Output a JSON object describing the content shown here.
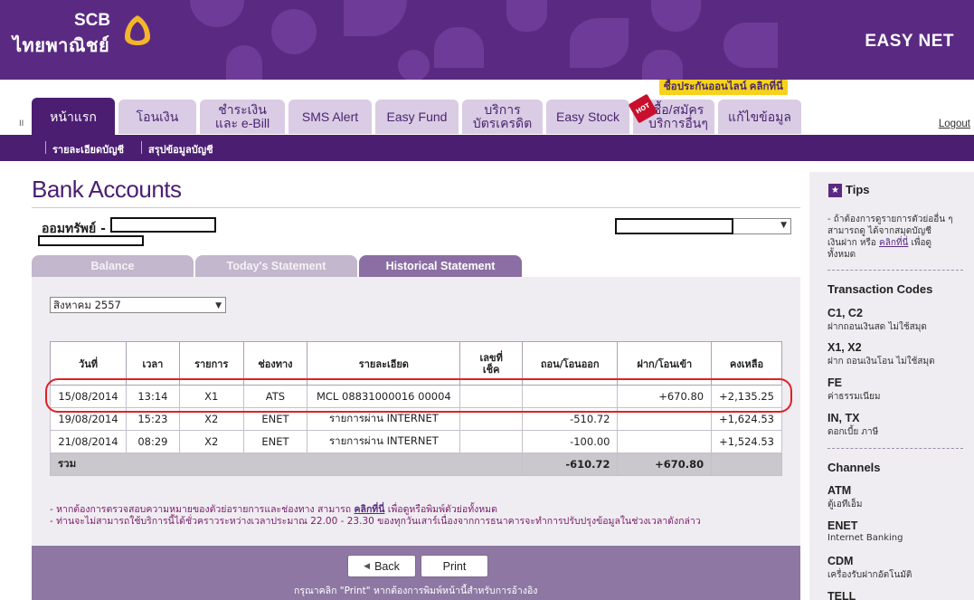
{
  "app": {
    "brand_en": "SCB",
    "brand_th": "ไทยพาณิชย์",
    "product": "EASY NET"
  },
  "nav": {
    "promo_badge": "ซื้อประกันออนไลน์ คลิกที่นี่",
    "hot_badge": "HOT",
    "tabs": [
      {
        "line1": "หน้าแรก",
        "line2": ""
      },
      {
        "line1": "โอนเงิน",
        "line2": ""
      },
      {
        "line1": "ชำระเงิน",
        "line2": "และ e-Bill"
      },
      {
        "line1": "SMS Alert",
        "line2": ""
      },
      {
        "line1": "Easy Fund",
        "line2": ""
      },
      {
        "line1": "บริการ",
        "line2": "บัตรเครดิต"
      },
      {
        "line1": "Easy Stock",
        "line2": ""
      },
      {
        "line1": "ซื้อ/สมัคร",
        "line2": "บริการอื่นๆ"
      },
      {
        "line1": "แก้ไขข้อมูล",
        "line2": ""
      }
    ],
    "marker": "II",
    "logout": "Logout",
    "subnav": [
      "รายละเอียดบัญชี",
      "สรุปข้อมูลบัญชี"
    ]
  },
  "page": {
    "title": "Bank Accounts",
    "account_type": "ออมทรัพย์ -",
    "statement_tabs": [
      "Balance",
      "Today's Statement",
      "Historical Statement"
    ],
    "month_value": "สิงหาคม 2557",
    "select_arrow": "▼"
  },
  "table": {
    "headers": [
      "วันที่",
      "เวลา",
      "รายการ",
      "ช่องทาง",
      "รายละเอียด",
      "เลขที่\nเช็ค",
      "ถอน/โอนออก",
      "ฝาก/โอนเข้า",
      "คงเหลือ"
    ],
    "rows": [
      {
        "date": "15/08/2014",
        "time": "13:14",
        "code": "X1",
        "channel": "ATS",
        "detail": "MCL 08831000016 00004",
        "cheque": "",
        "withdraw": "",
        "deposit": "+670.80",
        "balance": "+2,135.25"
      },
      {
        "date": "19/08/2014",
        "time": "15:23",
        "code": "X2",
        "channel": "ENET",
        "detail": "รายการผ่าน INTERNET",
        "cheque": "",
        "withdraw": "-510.72",
        "deposit": "",
        "balance": "+1,624.53"
      },
      {
        "date": "21/08/2014",
        "time": "08:29",
        "code": "X2",
        "channel": "ENET",
        "detail": "รายการผ่าน INTERNET",
        "cheque": "",
        "withdraw": "-100.00",
        "deposit": "",
        "balance": "+1,524.53"
      }
    ],
    "total": {
      "label": "รวม",
      "withdraw": "-610.72",
      "deposit": "+670.80"
    }
  },
  "notes": {
    "line1_pre": "- หากต้องการตรวจสอบความหมายของตัวย่อรายการและช่องทาง สามารถ",
    "line1_link": "คลิกที่นี่",
    "line1_post": "เพื่อดูหรือพิมพ์ตัวย่อทั้งหมด",
    "line2": "- ท่านจะไม่สามารถใช้บริการนี้ได้ชั่วคราวระหว่างเวลาประมาณ 22.00 - 23.30 ของทุกวันเสาร์เนื่องจากการธนาคารจะทำการปรับปรุงข้อมูลในช่วงเวลาดังกล่าว"
  },
  "footer": {
    "back_icon": "◀",
    "back_label": "Back",
    "print_label": "Print",
    "note": "กรุณาคลิก \"Print\" หากต้องการพิมพ์หน้านี้สำหรับการอ้างอิง"
  },
  "sidebar": {
    "tips_title": "Tips",
    "tips_icon": "★",
    "tips_text_1": "- ถ้าต้องการดูรายการตัวย่ออื่น ๆ",
    "tips_text_2": "สามารถดู ได้จากสมุดบัญชี",
    "tips_text_3_pre": "เงินฝาก หรือ ",
    "tips_text_3_link": "คลิกที่นี่",
    "tips_text_3_post": " เพื่อดู",
    "tips_text_4": "ทั้งหมด",
    "codes_title": "Transaction Codes",
    "codes": [
      {
        "code": "C1, C2",
        "desc": "ฝากถอนเงินสด ไม่ใช้สมุด"
      },
      {
        "code": "X1, X2",
        "desc": "ฝาก ถอนเงินโอน ไม่ใช้สมุด"
      },
      {
        "code": "FE",
        "desc": "ค่าธรรมเนียม"
      },
      {
        "code": "IN, TX",
        "desc": "ดอกเบี้ย ภาษี"
      }
    ],
    "channels_title": "Channels",
    "channels": [
      {
        "code": "ATM",
        "desc": "ตู้เอทีเอ็ม"
      },
      {
        "code": "ENET",
        "desc": "Internet Banking"
      },
      {
        "code": "CDM",
        "desc": "เครื่องรับฝากอัตโนมัติ"
      },
      {
        "code": "TELL",
        "desc": ""
      }
    ]
  }
}
